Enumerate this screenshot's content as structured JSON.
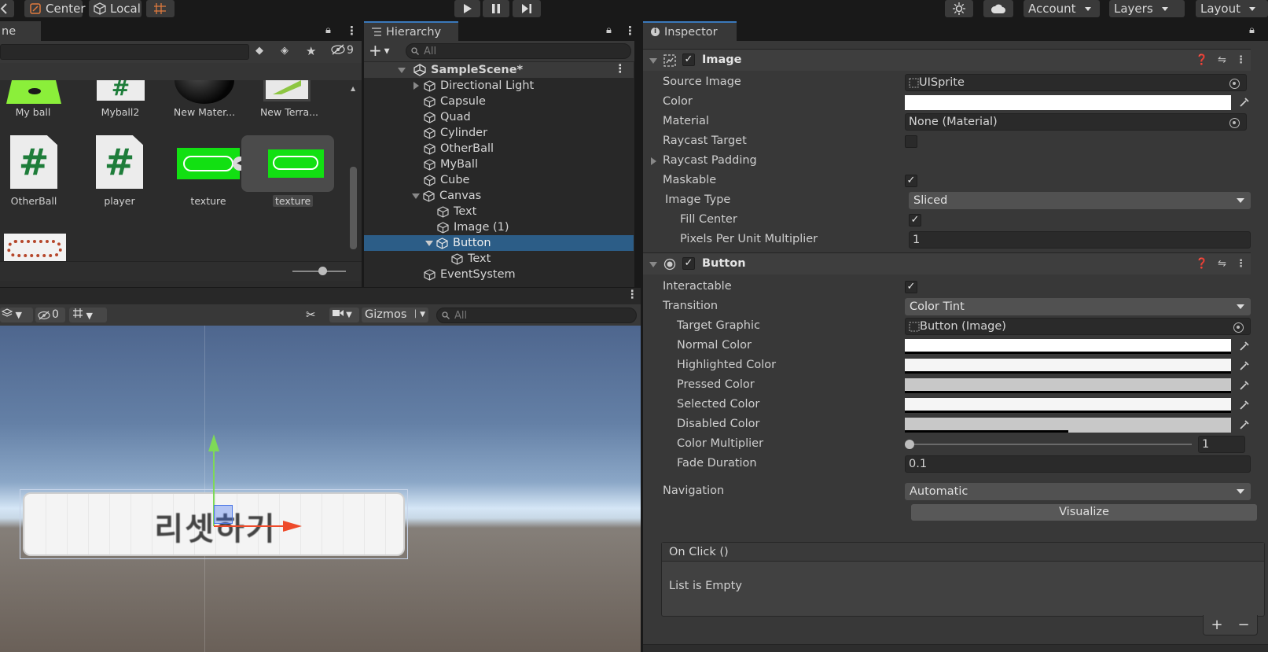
{
  "toolbar": {
    "pivot_label": "Center",
    "space_label": "Local",
    "account_label": "Account",
    "layers_label": "Layers",
    "layout_label": "Layout"
  },
  "project": {
    "tab_partial": "ne",
    "hidden_count": "9",
    "assets": [
      {
        "label": "My ball"
      },
      {
        "label": "Myball2"
      },
      {
        "label": "New Mater..."
      },
      {
        "label": "New Terra..."
      },
      {
        "label": "OtherBall"
      },
      {
        "label": "player"
      },
      {
        "label": "texture"
      },
      {
        "label": "texture"
      }
    ]
  },
  "hierarchy": {
    "tab_label": "Hierarchy",
    "search_placeholder": "All",
    "scene": "SampleScene*",
    "items": [
      {
        "label": "Directional Light"
      },
      {
        "label": "Capsule"
      },
      {
        "label": "Quad"
      },
      {
        "label": "Cylinder"
      },
      {
        "label": "OtherBall"
      },
      {
        "label": "MyBall"
      },
      {
        "label": "Cube"
      },
      {
        "label": "Canvas"
      },
      {
        "label": "Text"
      },
      {
        "label": "Image (1)"
      },
      {
        "label": "Button"
      },
      {
        "label": "Text"
      },
      {
        "label": "EventSystem"
      }
    ]
  },
  "scene_view": {
    "hidden_count": "0",
    "gizmos_label": "Gizmos",
    "search_placeholder": "All",
    "button_text": "리셋하기"
  },
  "inspector": {
    "tab_label": "Inspector",
    "image": {
      "title": "Image",
      "source_image_label": "Source Image",
      "source_image_value": "UISprite",
      "color_label": "Color",
      "material_label": "Material",
      "material_value": "None (Material)",
      "raycast_target_label": "Raycast Target",
      "raycast_padding_label": "Raycast Padding",
      "maskable_label": "Maskable",
      "image_type_label": "Image Type",
      "image_type_value": "Sliced",
      "fill_center_label": "Fill Center",
      "ppu_label": "Pixels Per Unit Multiplier",
      "ppu_value": "1"
    },
    "button": {
      "title": "Button",
      "interactable_label": "Interactable",
      "transition_label": "Transition",
      "transition_value": "Color Tint",
      "target_graphic_label": "Target Graphic",
      "target_graphic_value": "Button (Image)",
      "normal_color_label": "Normal Color",
      "highlighted_color_label": "Highlighted Color",
      "pressed_color_label": "Pressed Color",
      "selected_color_label": "Selected Color",
      "disabled_color_label": "Disabled Color",
      "color_multiplier_label": "Color Multiplier",
      "color_multiplier_value": "1",
      "fade_duration_label": "Fade Duration",
      "fade_duration_value": "0.1",
      "navigation_label": "Navigation",
      "navigation_value": "Automatic",
      "visualize_label": "Visualize",
      "onclick_label": "On Click ()",
      "list_empty_label": "List is Empty"
    }
  },
  "colors": {
    "accent": "#3a79bb",
    "selection": "#2c5d87",
    "panel": "#282828",
    "inspector": "#383838"
  }
}
